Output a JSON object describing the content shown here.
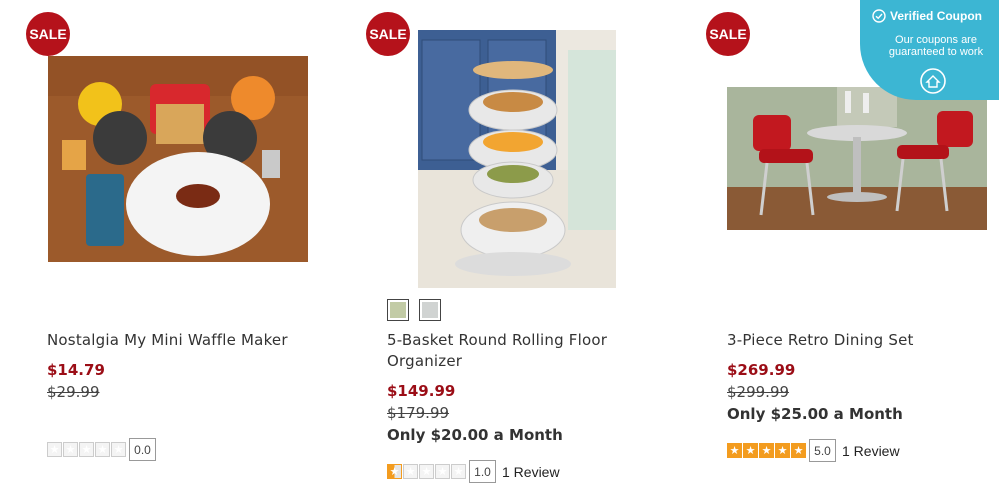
{
  "coupon": {
    "title": "Verified Coupon",
    "line1": "Our coupons are",
    "line2": "guaranteed to work",
    "color": "#3cb6d3"
  },
  "products": [
    {
      "badge": "SALE",
      "name": "Nostalgia My Mini Waffle Maker",
      "sale_price": "$14.79",
      "original_price": "$29.99",
      "rating_value": "0.0",
      "rating_stars": 0
    },
    {
      "badge": "SALE",
      "name_line1": "5-Basket Round Rolling Floor",
      "name_line2": "Organizer",
      "swatches": [
        "#c2cba5",
        "#d0d3d2"
      ],
      "sale_price": "$149.99",
      "original_price": "$179.99",
      "monthly": "Only $20.00 a Month",
      "rating_value": "1.0",
      "rating_stars": 1,
      "reviews": "1 Review"
    },
    {
      "badge": "SALE",
      "name": "3-Piece Retro Dining Set",
      "sale_price": "$269.99",
      "original_price": "$299.99",
      "monthly": "Only $25.00 a Month",
      "rating_value": "5.0",
      "rating_stars": 5,
      "reviews": "1 Review"
    }
  ],
  "colors": {
    "sale_badge": "#b5121b",
    "sale_price": "#9b0d16",
    "star_on": "#f39c1f"
  }
}
